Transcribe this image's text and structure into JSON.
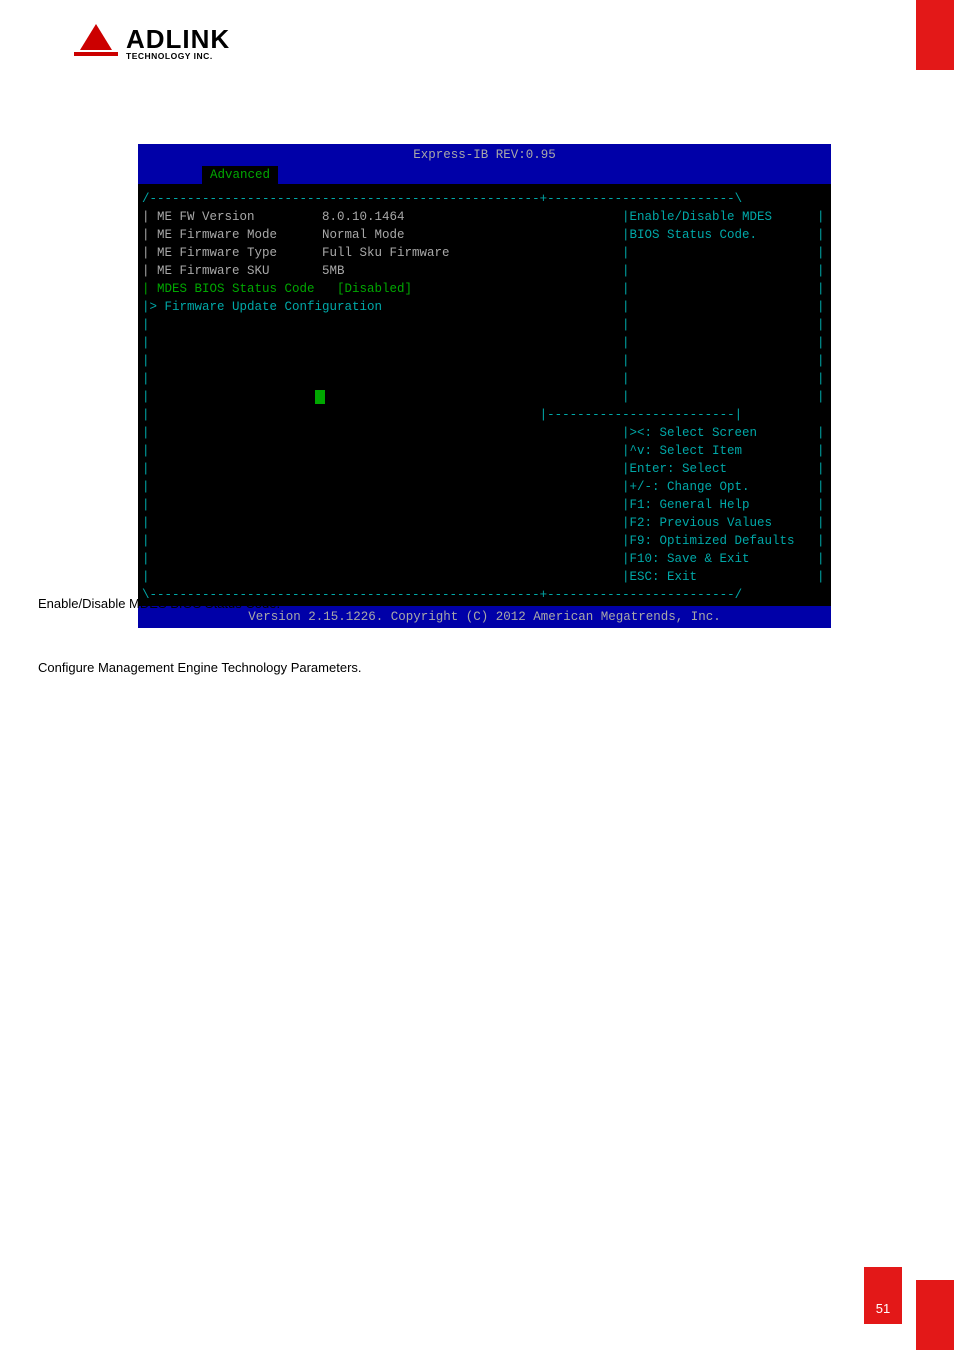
{
  "logo": {
    "big": "ADLINK",
    "small": "TECHNOLOGY INC."
  },
  "bios": {
    "title": "Express-IB REV:0.95",
    "tab": "Advanced",
    "topline": "/----------------------------------------------------+-------------------------\\",
    "midline": "|----------------------------------------------------+-------------------------|",
    "helpsep": "|                                                    |-------------------------|",
    "botline": "\\----------------------------------------------------+-------------------------/",
    "rows": [
      {
        "l": "| ME FW Version         8.0.10.1464",
        "r": "|Enable/Disable MDES      |",
        "lc": "gray",
        "rc": "cyan"
      },
      {
        "l": "| ME Firmware Mode      Normal Mode",
        "r": "|BIOS Status Code.        |",
        "lc": "gray",
        "rc": "cyan"
      },
      {
        "l": "| ME Firmware Type      Full Sku Firmware",
        "r": "|                         |",
        "lc": "gray",
        "rc": "cyan"
      },
      {
        "l": "| ME Firmware SKU       5MB",
        "r": "|                         |",
        "lc": "gray",
        "rc": "cyan"
      },
      {
        "l": "| MDES BIOS Status Code   [Disabled]",
        "r": "|                         |",
        "lc": "green",
        "rc": "cyan"
      },
      {
        "l": "|> Firmware Update Configuration",
        "r": "|                         |",
        "lc": "cyan",
        "rc": "cyan"
      },
      {
        "l": "|",
        "r": "|                         |",
        "lc": "cyan",
        "rc": "cyan"
      },
      {
        "l": "|",
        "r": "|                         |",
        "lc": "cyan",
        "rc": "cyan"
      },
      {
        "l": "|",
        "r": "|                         |",
        "lc": "cyan",
        "rc": "cyan"
      },
      {
        "l": "|",
        "r": "|                         |",
        "lc": "cyan",
        "rc": "cyan"
      }
    ],
    "help": [
      "|><: Select Screen        |",
      "|^v: Select Item          |",
      "|Enter: Select            |",
      "|+/-: Change Opt.         |",
      "|F1: General Help         |",
      "|F2: Previous Values      |",
      "|F9: Optimized Defaults   |",
      "|F10: Save & Exit         |",
      "|ESC: Exit                |"
    ],
    "footer": "Version 2.15.1226. Copyright (C) 2012 American Megatrends, Inc."
  },
  "para1": "Enable/Disable MDES BIOS Status Code.",
  "para2": "Configure Management Engine Technology Parameters.",
  "pagenum": "51"
}
